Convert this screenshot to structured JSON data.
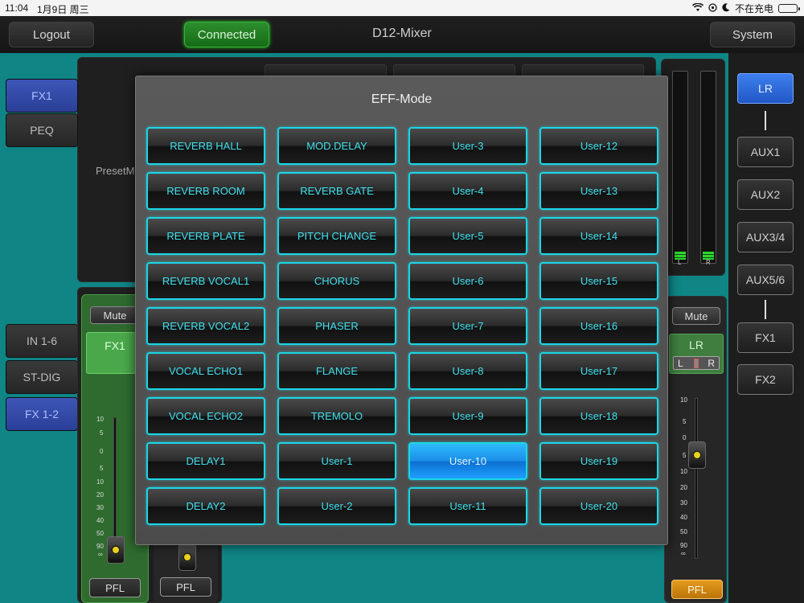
{
  "statusbar": {
    "time": "11:04",
    "date": "1月9日 周三",
    "charging": "不在充电"
  },
  "topbar": {
    "logout": "Logout",
    "connected": "Connected",
    "title": "D12-Mixer",
    "system": "System"
  },
  "left_tabs": {
    "fx1": "FX1",
    "peq": "PEQ"
  },
  "background": {
    "preset_label": "PresetM"
  },
  "channel_tabs": {
    "in16": "IN 1-6",
    "stdig": "ST-DIG",
    "fx12": "FX 1-2"
  },
  "fx1_strip": {
    "mute": "Mute",
    "name": "FX1",
    "pfl": "PFL",
    "scale": [
      "10",
      "5",
      "0",
      "5",
      "10",
      "20",
      "30",
      "40",
      "50",
      "90",
      "∞"
    ]
  },
  "fx2_strip": {
    "pfl": "PFL"
  },
  "lr_strip": {
    "mute": "Mute",
    "name": "LR",
    "l": "L",
    "r": "R",
    "pfl": "PFL",
    "scale": [
      "10",
      "5",
      "0",
      "5",
      "10",
      "20",
      "30",
      "40",
      "50",
      "90",
      "∞"
    ]
  },
  "meters": {
    "left": "L",
    "right": "R"
  },
  "bus": {
    "lr": "LR",
    "aux1": "AUX1",
    "aux2": "AUX2",
    "aux34": "AUX3/4",
    "aux56": "AUX5/6",
    "fx1": "FX1",
    "fx2": "FX2"
  },
  "modal": {
    "title": "EFF-Mode",
    "selected": "User-10",
    "items": [
      "REVERB HALL",
      "MOD.DELAY",
      "User-3",
      "User-12",
      "REVERB ROOM",
      "REVERB GATE",
      "User-4",
      "User-13",
      "REVERB PLATE",
      "PITCH CHANGE",
      "User-5",
      "User-14",
      "REVERB VOCAL1",
      "CHORUS",
      "User-6",
      "User-15",
      "REVERB VOCAL2",
      "PHASER",
      "User-7",
      "User-16",
      "VOCAL ECHO1",
      "FLANGE",
      "User-8",
      "User-17",
      "VOCAL ECHO2",
      "TREMOLO",
      "User-9",
      "User-18",
      "DELAY1",
      "User-1",
      "User-10",
      "User-19",
      "DELAY2",
      "User-2",
      "User-11",
      "User-20"
    ]
  },
  "colors": {
    "accent": "#1bd6e6",
    "selected": "#1b8ee6",
    "teal": "#0f8585",
    "connected": "#176b17",
    "pfl_on": "#e49b1d"
  }
}
